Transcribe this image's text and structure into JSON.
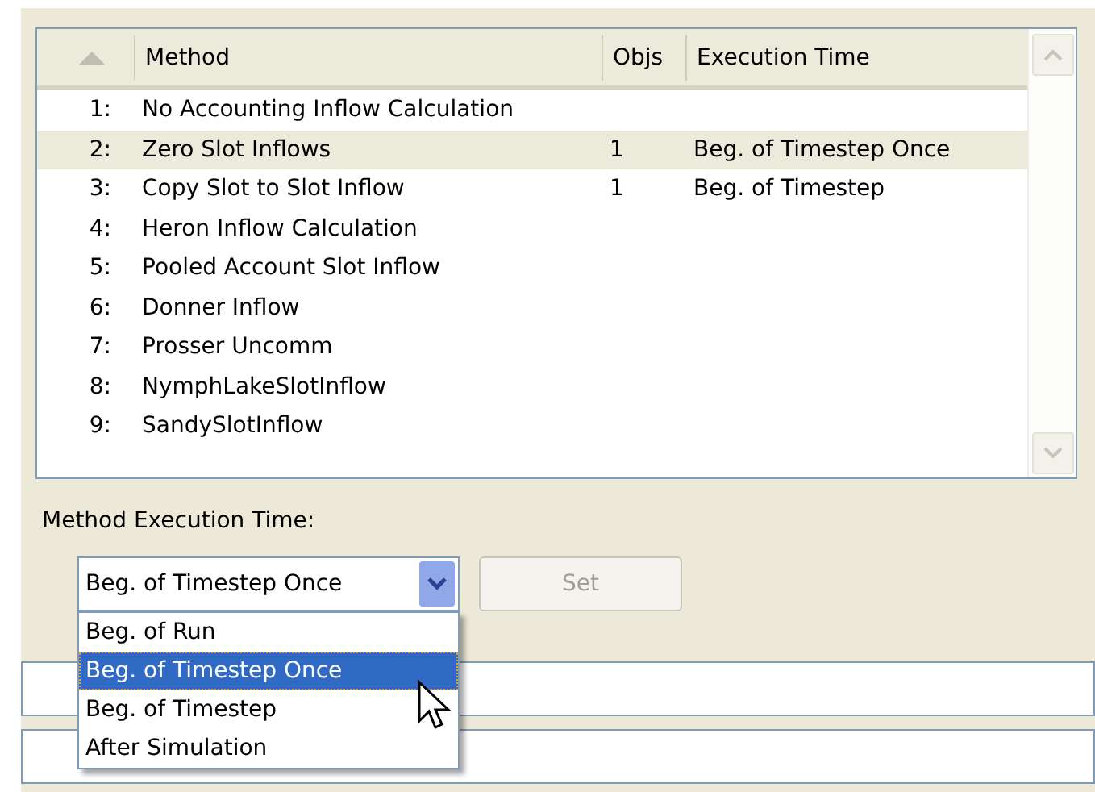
{
  "table": {
    "columns": [
      "Method",
      "Objs",
      "Execution Time"
    ],
    "rows": [
      {
        "index": "1:",
        "method": "No Accounting Inflow Calculation",
        "objs": "",
        "time": "",
        "selected": false
      },
      {
        "index": "2:",
        "method": "Zero Slot Inflows",
        "objs": "1",
        "time": "Beg. of Timestep Once",
        "selected": true
      },
      {
        "index": "3:",
        "method": "Copy Slot to Slot Inflow",
        "objs": "1",
        "time": "Beg. of Timestep",
        "selected": false
      },
      {
        "index": "4:",
        "method": "Heron Inflow Calculation",
        "objs": "",
        "time": "",
        "selected": false
      },
      {
        "index": "5:",
        "method": "Pooled Account Slot Inflow",
        "objs": "",
        "time": "",
        "selected": false
      },
      {
        "index": "6:",
        "method": "Donner Inflow",
        "objs": "",
        "time": "",
        "selected": false
      },
      {
        "index": "7:",
        "method": "Prosser Uncomm",
        "objs": "",
        "time": "",
        "selected": false
      },
      {
        "index": "8:",
        "method": "NymphLakeSlotInflow",
        "objs": "",
        "time": "",
        "selected": false
      },
      {
        "index": "9:",
        "method": "SandySlotInflow",
        "objs": "",
        "time": "",
        "selected": false
      }
    ]
  },
  "execution_label": "Method Execution Time:",
  "combo": {
    "value": "Beg. of Timestep Once",
    "expanded": true,
    "options": [
      {
        "label": "Beg. of Run",
        "selected": false
      },
      {
        "label": "Beg. of Timestep Once",
        "selected": true
      },
      {
        "label": "Beg. of Timestep",
        "selected": false
      },
      {
        "label": "After Simulation",
        "selected": false
      }
    ]
  },
  "set_button": {
    "label": "Set",
    "disabled": true
  }
}
